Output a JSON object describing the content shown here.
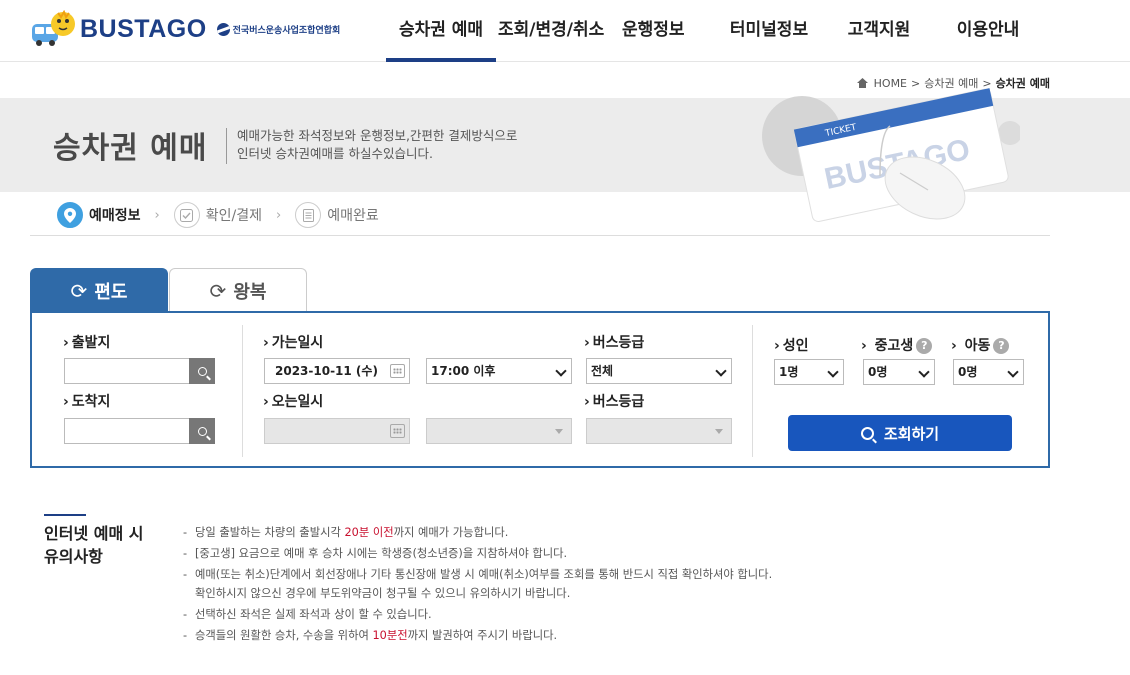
{
  "header": {
    "logo_text": "BUSTAGO",
    "logo_sub": "전국버스운송사업조합연합회",
    "nav": [
      {
        "label": "승차권 예매",
        "active": true
      },
      {
        "label": "조회/변경/취소",
        "active": false
      },
      {
        "label": "운행정보",
        "active": false
      },
      {
        "label": "터미널정보",
        "active": false
      },
      {
        "label": "고객지원",
        "active": false
      },
      {
        "label": "이용안내",
        "active": false
      }
    ]
  },
  "breadcrumb": {
    "home": "HOME",
    "sep": ">",
    "level1": "승차권 예매",
    "current": "승차권 예매"
  },
  "banner": {
    "title": "승차권 예매",
    "desc_line1": "예매가능한 좌석정보와 운행정보,간편한 결제방식으로",
    "desc_line2": "인터넷 승차권예매를 하실수있습니다.",
    "ticket_label": "TICKET",
    "ticket_brand": "BUSTAGO"
  },
  "steps": [
    {
      "label": "예매정보",
      "icon": "location-pin-icon",
      "active": true
    },
    {
      "label": "확인/결제",
      "icon": "check-box-icon",
      "active": false
    },
    {
      "label": "예매완료",
      "icon": "document-icon",
      "active": false
    }
  ],
  "tabs": [
    {
      "label": "편도",
      "icon": "refresh-icon",
      "active": true
    },
    {
      "label": "왕복",
      "icon": "refresh-icon",
      "active": false
    }
  ],
  "form": {
    "departure_label": "출발지",
    "arrival_label": "도착지",
    "departure_value": "",
    "arrival_value": "",
    "go_date_label": "가는일시",
    "go_date_value": "2023-10-11 (수)",
    "go_time_value": "17:00 이후",
    "bus_class_label": "버스등급",
    "bus_class_value": "전체",
    "return_date_label": "오는일시",
    "return_bus_class_label": "버스등급",
    "adult_label": "성인",
    "adult_value": "1명",
    "youth_label": "중고생",
    "youth_value": "0명",
    "child_label": "아동",
    "child_value": "0명",
    "help_mark": "?",
    "query_button": "조회하기"
  },
  "notice": {
    "title_line1": "인터넷 예매 시",
    "title_line2": "유의사항",
    "items": [
      {
        "pre": "당일 출발하는 차량의 출발시각 ",
        "highlight": "20분 이전",
        "post": "까지 예매가 가능합니다."
      },
      {
        "pre": "[중고생] 요금으로 예매 후 승차 시에는 학생증(청소년증)을 지참하셔야 합니다.",
        "highlight": "",
        "post": ""
      },
      {
        "pre": "예매(또는 취소)단계에서 회선장애나 기타 통신장애 발생 시 예매(취소)여부를 조회를 통해 반드시 직접 확인하셔야 합니다.",
        "highlight": "",
        "post": "",
        "line2": "확인하시지 않으신 경우에 부도위약금이 청구될 수 있으니 유의하시기 바랍니다."
      },
      {
        "pre": "선택하신 좌석은 실제 좌석과 상이 할 수 있습니다.",
        "highlight": "",
        "post": ""
      },
      {
        "pre": "승객들의 원활한 승차, 수송을 위하여 ",
        "highlight": "10분전",
        "post": "까지 발권하여 주시기 바랍니다."
      }
    ]
  },
  "colors": {
    "brand_navy": "#1d3f86",
    "tab_blue": "#2f6aa8",
    "button_blue": "#1856bd",
    "step_active": "#3fa0e0",
    "highlight_red": "#c8102e"
  }
}
